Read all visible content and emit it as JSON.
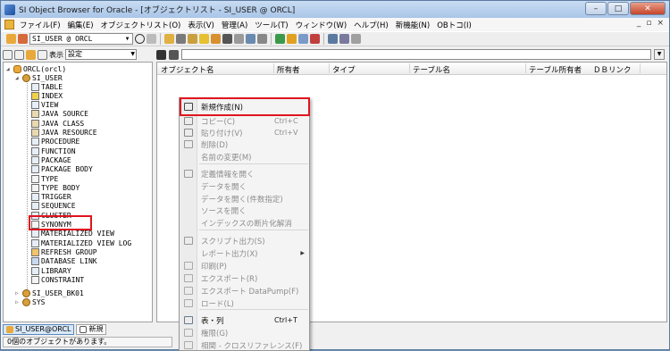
{
  "window": {
    "title": "SI Object Browser for Oracle - [オブジェクトリスト - SI_USER @ ORCL]"
  },
  "menubar": {
    "items": [
      "ファイル(F)",
      "編集(E)",
      "オブジェクトリスト(O)",
      "表示(V)",
      "管理(A)",
      "ツール(T)",
      "ウィンドウ(W)",
      "ヘルプ(H)",
      "新機能(N)",
      "OBトコ(I)"
    ]
  },
  "toolbar": {
    "connection": "SI_USER @ ORCL"
  },
  "left_toolbar": {
    "display_label": "表示",
    "view_value": "設定"
  },
  "tree": {
    "root": "ORCL(orcl)",
    "user": "SI_USER",
    "items": [
      "TABLE",
      "INDEX",
      "VIEW",
      "JAVA SOURCE",
      "JAVA CLASS",
      "JAVA RESOURCE",
      "PROCEDURE",
      "FUNCTION",
      "PACKAGE",
      "PACKAGE BODY",
      "TYPE",
      "TYPE BODY",
      "TRIGGER",
      "SEQUENCE",
      "CLUSTER",
      "SYNONYM",
      "MATERIALIZED VIEW",
      "MATERIALIZED VIEW LOG",
      "REFRESH GROUP",
      "DATABASE LINK",
      "LIBRARY",
      "CONSTRAINT"
    ],
    "other_users": [
      "SI_USER_BK01",
      "SYS"
    ]
  },
  "list": {
    "columns": [
      "オブジェクト名",
      "所有者",
      "タイプ",
      "テーブル名",
      "テーブル所有者",
      "ＤＢリンク"
    ]
  },
  "context_menu": {
    "items": [
      {
        "label": "新規作成(N)",
        "shortcut": "",
        "enabled": true
      },
      {
        "label": "コピー(C)",
        "shortcut": "Ctrl+C",
        "enabled": false
      },
      {
        "label": "貼り付け(V)",
        "shortcut": "Ctrl+V",
        "enabled": false
      },
      {
        "label": "削除(D)",
        "shortcut": "",
        "enabled": false
      },
      {
        "label": "名前の変更(M)",
        "shortcut": "",
        "enabled": false
      },
      {
        "label": "定義情報を開く",
        "shortcut": "",
        "enabled": false
      },
      {
        "label": "データを開く",
        "shortcut": "",
        "enabled": false
      },
      {
        "label": "データを開く(件数指定)",
        "shortcut": "",
        "enabled": false
      },
      {
        "label": "ソースを開く",
        "shortcut": "",
        "enabled": false
      },
      {
        "label": "インデックスの断片化解消",
        "shortcut": "",
        "enabled": false
      },
      {
        "label": "スクリプト出力(S)",
        "shortcut": "",
        "enabled": false
      },
      {
        "label": "レポート出力(X)",
        "shortcut": "",
        "enabled": false
      },
      {
        "label": "印刷(P)",
        "shortcut": "",
        "enabled": false
      },
      {
        "label": "エクスポート(R)",
        "shortcut": "",
        "enabled": false
      },
      {
        "label": "エクスポート DataPump(F)",
        "shortcut": "",
        "enabled": false
      },
      {
        "label": "ロード(L)",
        "shortcut": "",
        "enabled": false
      },
      {
        "label": "表・列",
        "shortcut": "Ctrl+T",
        "enabled": true
      },
      {
        "label": "権限(G)",
        "shortcut": "",
        "enabled": false
      },
      {
        "label": "相関 - クロスリファレンス(F)",
        "shortcut": "",
        "enabled": false
      }
    ]
  },
  "bottom_tabs": [
    "SI_USER@ORCL",
    "新規"
  ],
  "status": {
    "text": "0個のオブジェクトがあります。"
  }
}
